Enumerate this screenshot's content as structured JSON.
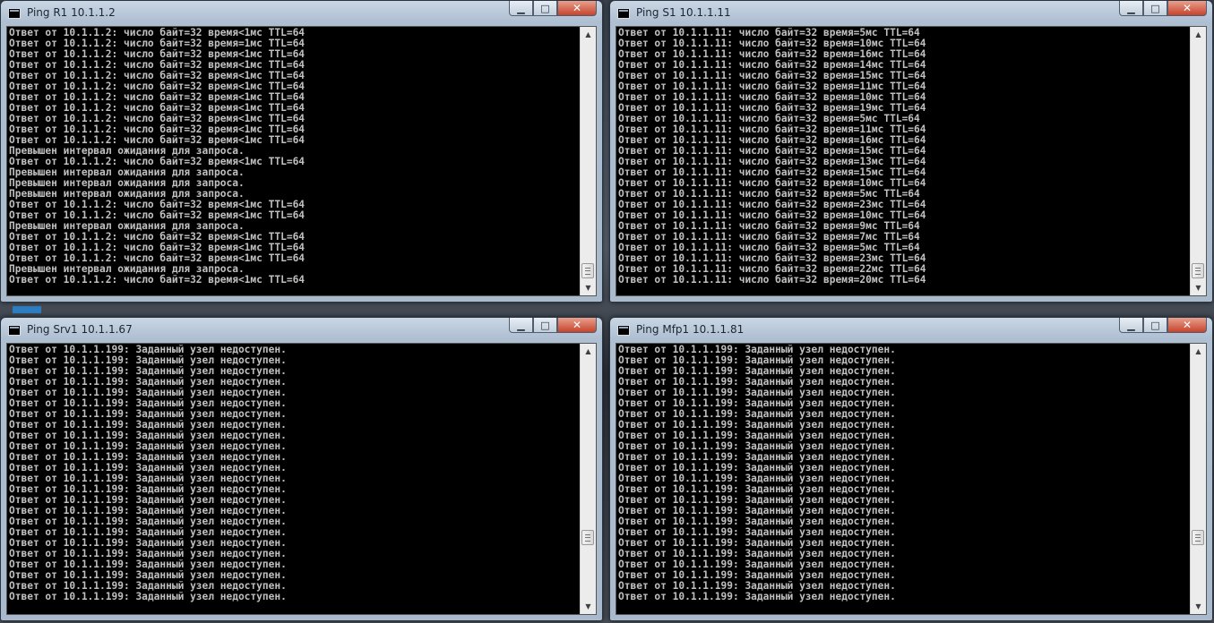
{
  "windows": {
    "w1": {
      "title": "Ping R1 10.1.1.2",
      "lines": [
        "Ответ от 10.1.1.2: число байт=32 время<1мс TTL=64",
        "Ответ от 10.1.1.2: число байт=32 время=1мс TTL=64",
        "Ответ от 10.1.1.2: число байт=32 время<1мс TTL=64",
        "Ответ от 10.1.1.2: число байт=32 время<1мс TTL=64",
        "Ответ от 10.1.1.2: число байт=32 время<1мс TTL=64",
        "Ответ от 10.1.1.2: число байт=32 время<1мс TTL=64",
        "Ответ от 10.1.1.2: число байт=32 время<1мс TTL=64",
        "Ответ от 10.1.1.2: число байт=32 время<1мс TTL=64",
        "Ответ от 10.1.1.2: число байт=32 время<1мс TTL=64",
        "Ответ от 10.1.1.2: число байт=32 время<1мс TTL=64",
        "Ответ от 10.1.1.2: число байт=32 время<1мс TTL=64",
        "Превышен интервал ожидания для запроса.",
        "Ответ от 10.1.1.2: число байт=32 время<1мс TTL=64",
        "Превышен интервал ожидания для запроса.",
        "Превышен интервал ожидания для запроса.",
        "Превышен интервал ожидания для запроса.",
        "Ответ от 10.1.1.2: число байт=32 время<1мс TTL=64",
        "Ответ от 10.1.1.2: число байт=32 время<1мс TTL=64",
        "Превышен интервал ожидания для запроса.",
        "Ответ от 10.1.1.2: число байт=32 время<1мс TTL=64",
        "Ответ от 10.1.1.2: число байт=32 время<1мс TTL=64",
        "Ответ от 10.1.1.2: число байт=32 время<1мс TTL=64",
        "Превышен интервал ожидания для запроса.",
        "Ответ от 10.1.1.2: число байт=32 время<1мс TTL=64"
      ]
    },
    "w2": {
      "title": "Ping S1 10.1.1.11",
      "lines": [
        "Ответ от 10.1.1.11: число байт=32 время=5мс TTL=64",
        "Ответ от 10.1.1.11: число байт=32 время=10мс TTL=64",
        "Ответ от 10.1.1.11: число байт=32 время=16мс TTL=64",
        "Ответ от 10.1.1.11: число байт=32 время=14мс TTL=64",
        "Ответ от 10.1.1.11: число байт=32 время=15мс TTL=64",
        "Ответ от 10.1.1.11: число байт=32 время=11мс TTL=64",
        "Ответ от 10.1.1.11: число байт=32 время=10мс TTL=64",
        "Ответ от 10.1.1.11: число байт=32 время=19мс TTL=64",
        "Ответ от 10.1.1.11: число байт=32 время=5мс TTL=64",
        "Ответ от 10.1.1.11: число байт=32 время=11мс TTL=64",
        "Ответ от 10.1.1.11: число байт=32 время=16мс TTL=64",
        "Ответ от 10.1.1.11: число байт=32 время=15мс TTL=64",
        "Ответ от 10.1.1.11: число байт=32 время=13мс TTL=64",
        "Ответ от 10.1.1.11: число байт=32 время=15мс TTL=64",
        "Ответ от 10.1.1.11: число байт=32 время=10мс TTL=64",
        "Ответ от 10.1.1.11: число байт=32 время=5мс TTL=64",
        "Ответ от 10.1.1.11: число байт=32 время=23мс TTL=64",
        "Ответ от 10.1.1.11: число байт=32 время=10мс TTL=64",
        "Ответ от 10.1.1.11: число байт=32 время=9мс TTL=64",
        "Ответ от 10.1.1.11: число байт=32 время=7мс TTL=64",
        "Ответ от 10.1.1.11: число байт=32 время=5мс TTL=64",
        "Ответ от 10.1.1.11: число байт=32 время=23мс TTL=64",
        "Ответ от 10.1.1.11: число байт=32 время=22мс TTL=64",
        "Ответ от 10.1.1.11: число байт=32 время=20мс TTL=64"
      ]
    },
    "w3": {
      "title": "Ping Srv1 10.1.1.67",
      "lines": [
        "Ответ от 10.1.1.199: Заданный узел недоступен.",
        "Ответ от 10.1.1.199: Заданный узел недоступен.",
        "Ответ от 10.1.1.199: Заданный узел недоступен.",
        "Ответ от 10.1.1.199: Заданный узел недоступен.",
        "Ответ от 10.1.1.199: Заданный узел недоступен.",
        "Ответ от 10.1.1.199: Заданный узел недоступен.",
        "Ответ от 10.1.1.199: Заданный узел недоступен.",
        "Ответ от 10.1.1.199: Заданный узел недоступен.",
        "Ответ от 10.1.1.199: Заданный узел недоступен.",
        "Ответ от 10.1.1.199: Заданный узел недоступен.",
        "Ответ от 10.1.1.199: Заданный узел недоступен.",
        "Ответ от 10.1.1.199: Заданный узел недоступен.",
        "Ответ от 10.1.1.199: Заданный узел недоступен.",
        "Ответ от 10.1.1.199: Заданный узел недоступен.",
        "Ответ от 10.1.1.199: Заданный узел недоступен.",
        "Ответ от 10.1.1.199: Заданный узел недоступен.",
        "Ответ от 10.1.1.199: Заданный узел недоступен.",
        "Ответ от 10.1.1.199: Заданный узел недоступен.",
        "Ответ от 10.1.1.199: Заданный узел недоступен.",
        "Ответ от 10.1.1.199: Заданный узел недоступен.",
        "Ответ от 10.1.1.199: Заданный узел недоступен.",
        "Ответ от 10.1.1.199: Заданный узел недоступен.",
        "Ответ от 10.1.1.199: Заданный узел недоступен.",
        "Ответ от 10.1.1.199: Заданный узел недоступен."
      ]
    },
    "w4": {
      "title": "Ping Mfp1 10.1.1.81",
      "lines": [
        "Ответ от 10.1.1.199: Заданный узел недоступен.",
        "Ответ от 10.1.1.199: Заданный узел недоступен.",
        "Ответ от 10.1.1.199: Заданный узел недоступен.",
        "Ответ от 10.1.1.199: Заданный узел недоступен.",
        "Ответ от 10.1.1.199: Заданный узел недоступен.",
        "Ответ от 10.1.1.199: Заданный узел недоступен.",
        "Ответ от 10.1.1.199: Заданный узел недоступен.",
        "Ответ от 10.1.1.199: Заданный узел недоступен.",
        "Ответ от 10.1.1.199: Заданный узел недоступен.",
        "Ответ от 10.1.1.199: Заданный узел недоступен.",
        "Ответ от 10.1.1.199: Заданный узел недоступен.",
        "Ответ от 10.1.1.199: Заданный узел недоступен.",
        "Ответ от 10.1.1.199: Заданный узел недоступен.",
        "Ответ от 10.1.1.199: Заданный узел недоступен.",
        "Ответ от 10.1.1.199: Заданный узел недоступен.",
        "Ответ от 10.1.1.199: Заданный узел недоступен.",
        "Ответ от 10.1.1.199: Заданный узел недоступен.",
        "Ответ от 10.1.1.199: Заданный узел недоступен.",
        "Ответ от 10.1.1.199: Заданный узел недоступен.",
        "Ответ от 10.1.1.199: Заданный узел недоступен.",
        "Ответ от 10.1.1.199: Заданный узел недоступен.",
        "Ответ от 10.1.1.199: Заданный узел недоступен.",
        "Ответ от 10.1.1.199: Заданный узел недоступен.",
        "Ответ от 10.1.1.199: Заданный узел недоступен."
      ]
    }
  },
  "controls": {
    "minimize_glyph": "▁",
    "maximize_glyph": "□",
    "close_glyph": "✕"
  },
  "scroll_icons": {
    "up": "▲",
    "down": "▼"
  },
  "colors": {
    "console_bg": "#000000",
    "console_text": "#c0c0c0",
    "close_button": "#c7432b"
  }
}
